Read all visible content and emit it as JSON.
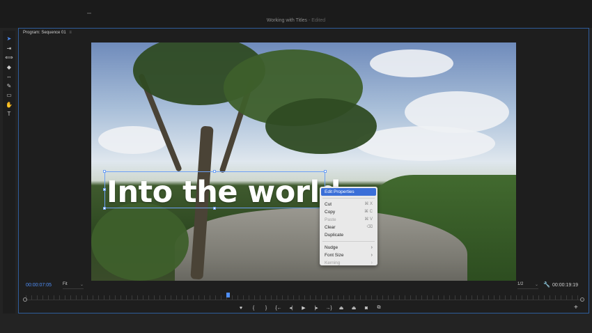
{
  "window": {
    "title": "Working with Titles",
    "status": "Edited"
  },
  "toolbar": {
    "tools": [
      {
        "name": "selection-tool-icon",
        "glyph": "➤"
      },
      {
        "name": "track-select-icon",
        "glyph": "⇥"
      },
      {
        "name": "ripple-edit-icon",
        "glyph": "⟺"
      },
      {
        "name": "razor-tool-icon",
        "glyph": "◆"
      },
      {
        "name": "slip-tool-icon",
        "glyph": "↔"
      },
      {
        "name": "pen-tool-icon",
        "glyph": "✎"
      },
      {
        "name": "rectangle-tool-icon",
        "glyph": "▭"
      },
      {
        "name": "hand-tool-icon",
        "glyph": "✋"
      },
      {
        "name": "type-tool-icon",
        "glyph": "T"
      }
    ]
  },
  "panel": {
    "tab_label": "Program: Sequence 01",
    "menu_glyph": "≡"
  },
  "video": {
    "title_text": "Into the world"
  },
  "context_menu": {
    "items": [
      {
        "label": "Edit Properties",
        "shortcut": "",
        "highlighted": true,
        "disabled": false,
        "submenu": false
      },
      {
        "sep": true
      },
      {
        "label": "Cut",
        "shortcut": "⌘ X",
        "disabled": false,
        "submenu": false
      },
      {
        "label": "Copy",
        "shortcut": "⌘ C",
        "disabled": false,
        "submenu": false
      },
      {
        "label": "Paste",
        "shortcut": "⌘ V",
        "disabled": true,
        "submenu": false
      },
      {
        "label": "Clear",
        "shortcut": "⌫",
        "disabled": false,
        "submenu": false
      },
      {
        "label": "Duplicate",
        "shortcut": "",
        "disabled": false,
        "submenu": false
      },
      {
        "sep": true
      },
      {
        "label": "Nudge",
        "shortcut": "",
        "disabled": false,
        "submenu": true
      },
      {
        "label": "Font Size",
        "shortcut": "",
        "disabled": false,
        "submenu": true
      },
      {
        "label": "Kerning",
        "shortcut": "",
        "disabled": true,
        "submenu": true
      }
    ]
  },
  "controls": {
    "timecode_current": "00:00:07:05",
    "zoom": "Fit",
    "resolution": "1/2",
    "timecode_duration": "00:00:19:19",
    "playhead_fraction": 0.36,
    "transport": [
      {
        "name": "add-marker-icon",
        "glyph": "♥"
      },
      {
        "name": "mark-in-icon",
        "glyph": "{"
      },
      {
        "name": "mark-out-icon",
        "glyph": "}"
      },
      {
        "name": "go-to-in-icon",
        "glyph": "{←"
      },
      {
        "name": "step-back-icon",
        "glyph": "◂|"
      },
      {
        "name": "play-icon",
        "glyph": "▶"
      },
      {
        "name": "step-forward-icon",
        "glyph": "|▸"
      },
      {
        "name": "go-to-out-icon",
        "glyph": "→}"
      },
      {
        "name": "lift-icon",
        "glyph": "⏏"
      },
      {
        "name": "extract-icon",
        "glyph": "⏏"
      },
      {
        "name": "export-frame-icon",
        "glyph": "◙"
      },
      {
        "name": "compare-view-icon",
        "glyph": "⧉"
      }
    ],
    "add_button": "+"
  },
  "colors": {
    "accent": "#4f8ef7",
    "selection": "#6da0f5",
    "menu_highlight": "#3b6fd8"
  }
}
